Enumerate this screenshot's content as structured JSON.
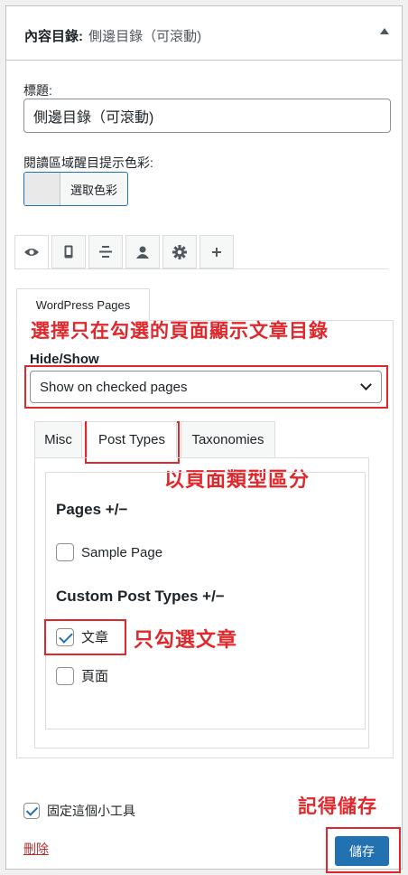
{
  "widget": {
    "title_prefix": "內容目錄:",
    "title_value": "側邊目錄（可滾動)"
  },
  "fields": {
    "title_label": "標題:",
    "title_value": "側邊目錄（可滾動)",
    "color_label": "閱讀區域醒目提示色彩:",
    "color_button": "選取色彩"
  },
  "icon_tabs": [
    {
      "icon": "eye-icon",
      "glyph": "👁"
    },
    {
      "icon": "mobile-icon",
      "glyph": "▯"
    },
    {
      "icon": "align-icon",
      "glyph": "≡"
    },
    {
      "icon": "user-icon",
      "glyph": "👤"
    },
    {
      "icon": "gear-icon",
      "glyph": "⚙"
    },
    {
      "icon": "plus-icon",
      "glyph": "+"
    }
  ],
  "wp_tab": "WordPress Pages",
  "hide_show": {
    "label": "Hide/Show",
    "selected": "Show on checked pages"
  },
  "sub_tabs": [
    "Misc",
    "Post Types",
    "Taxonomies"
  ],
  "pages_group": {
    "title": "Pages +/−",
    "items": [
      {
        "label": "Sample Page",
        "checked": false
      }
    ]
  },
  "custom_group": {
    "title": "Custom Post Types +/−",
    "items": [
      {
        "label": "文章",
        "checked": true
      },
      {
        "label": "頁面",
        "checked": false
      }
    ]
  },
  "footer": {
    "pin_label": "固定這個小工具",
    "pin_checked": true,
    "delete": "刪除",
    "save": "儲存"
  },
  "annotations": {
    "select_note": "選擇只在勾選的頁面顯示文章目錄",
    "posttypes_note": "以頁面類型區分",
    "only_posts_note": "只勾選文章",
    "save_note": "記得儲存"
  },
  "colors": {
    "accent": "#2271b1",
    "annotation_red": "#e0282c",
    "delete_red": "#b32d2e"
  }
}
